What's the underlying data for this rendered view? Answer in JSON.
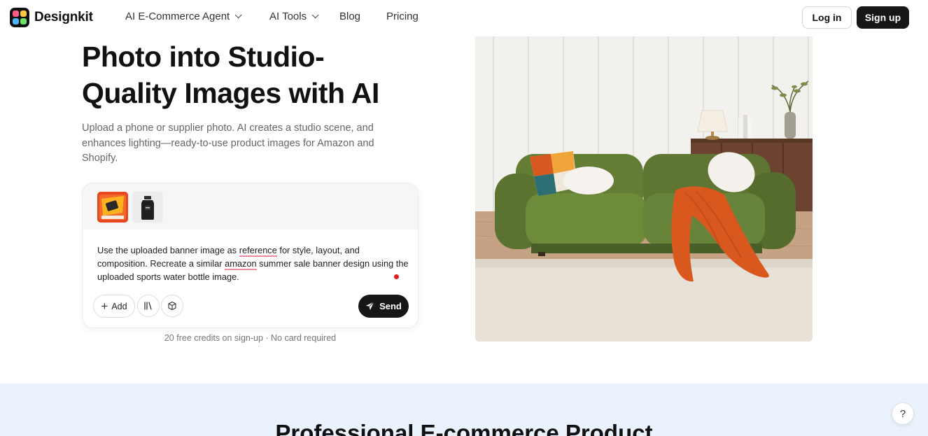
{
  "nav": {
    "brand": "Designkit",
    "items": [
      {
        "label": "AI E-Commerce Agent",
        "has_dropdown": true
      },
      {
        "label": "AI Tools",
        "has_dropdown": true
      },
      {
        "label": "Blog",
        "has_dropdown": false
      },
      {
        "label": "Pricing",
        "has_dropdown": false
      }
    ],
    "login_label": "Log in",
    "signup_label": "Sign up"
  },
  "hero": {
    "title_line1": "Photo into Studio-",
    "title_line2": "Quality Images with AI",
    "subtitle_line1": "Upload a phone or supplier photo. AI creates a studio scene, and",
    "subtitle_line2": "enhances lighting—ready-to-use product images for Amazon and",
    "subtitle_line3": "Shopify."
  },
  "prompt_card": {
    "prompt_parts": {
      "p1": "Use the uploaded banner image as ",
      "w1": "reference",
      "p2": " for style, layout, and composition. Recreate a similar ",
      "w2": "amazon",
      "p3": " summer sale banner design using the uploaded sports water bottle image."
    },
    "add_label": "Add",
    "send_label": "Send",
    "attachments": [
      "banner-image-thumbnail",
      "water-bottle-thumbnail"
    ]
  },
  "credits_note": "20 free credits on sign-up · No card required",
  "lower_section": {
    "title": "Professional E-commerce Product"
  },
  "help_label": "?",
  "colors": {
    "primary_button": "#161616",
    "lower_section_bg": "#eaf3fd",
    "sofa_green": "#5f7a34",
    "throw_orange": "#d8581e"
  }
}
